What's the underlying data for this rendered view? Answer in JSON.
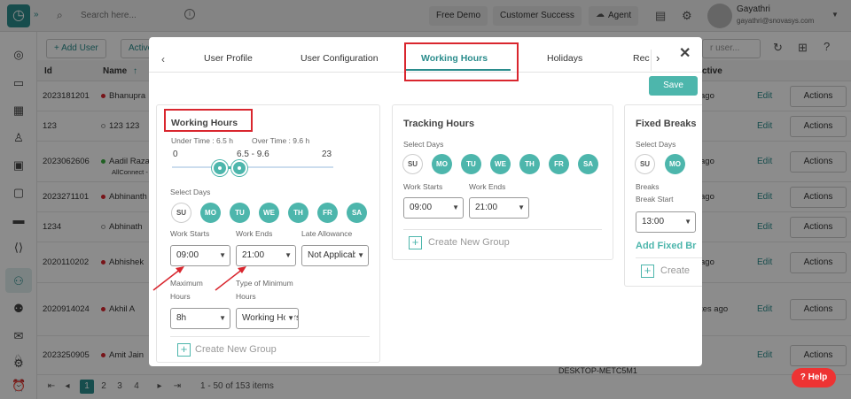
{
  "topbar": {
    "search_placeholder": "Search here...",
    "buttons": [
      "Free Demo",
      "Customer Success",
      "Agent"
    ],
    "user_name": "Gayathri",
    "user_email": "gayathri@snovasys.com"
  },
  "toolbar": {
    "add_user": "Add User",
    "active": "Active",
    "search_user": "r user..."
  },
  "table": {
    "headers": {
      "id": "Id",
      "name": "Name",
      "active": "ctive"
    },
    "rows": [
      {
        "id": "2023181201",
        "name": "Bhanupra",
        "dot": "#d9262e",
        "active": "ago"
      },
      {
        "id": "123",
        "name": "123 123",
        "dot": "",
        "active": ""
      },
      {
        "id": "2023062606",
        "name": "Aadil Raza",
        "sub": "AllConnect -",
        "dot": "#3cb043",
        "active": "ago"
      },
      {
        "id": "2023271101",
        "name": "Abhinanth",
        "dot": "#d9262e",
        "active": "ago"
      },
      {
        "id": "1234",
        "name": "Abhinath",
        "dot": "",
        "active": ""
      },
      {
        "id": "2020110202",
        "name": "Abhishek",
        "dot": "#d9262e",
        "active": "ago"
      },
      {
        "id": "2020914024",
        "name": "Akhil A",
        "dot": "#d9262e",
        "active": "tes ago"
      },
      {
        "id": "2023250905",
        "name": "Amit Jain",
        "dot": "#d9262e",
        "active": ""
      }
    ],
    "edit_label": "Edit",
    "actions_label": "Actions",
    "desktop_name": "DESKTOP-METC5M1"
  },
  "pager": {
    "pages": [
      "1",
      "2",
      "3",
      "4"
    ],
    "range": "1 - 50 of 153 items"
  },
  "help_label": "Help",
  "modal": {
    "tabs": [
      "User Profile",
      "User Configuration",
      "Working Hours",
      "Holidays",
      "Rec"
    ],
    "active_tab": "Working Hours",
    "save_label": "Save",
    "working_hours": {
      "title": "Working Hours",
      "under_time": "Under Time : 6.5 h",
      "over_time": "Over Time : 9.6 h",
      "slider_min": "0",
      "slider_max": "23",
      "slider_range": "6.5 - 9.6",
      "select_days": "Select Days",
      "days": [
        "SU",
        "MO",
        "TU",
        "WE",
        "TH",
        "FR",
        "SA"
      ],
      "work_starts_label": "Work Starts",
      "work_starts": "09:00",
      "work_ends_label": "Work Ends",
      "work_ends": "21:00",
      "late_allowance_label": "Late Allowance",
      "late_allowance": "Not Applicable",
      "maximum_hours_label_1": "Maximum",
      "maximum_hours_label_2": "Hours",
      "maximum_hours": "8h",
      "type_min_label_1": "Type of Minimum",
      "type_min_label_2": "Hours",
      "type_min": "Working Hours",
      "create_group": "Create New Group"
    },
    "tracking_hours": {
      "title": "Tracking Hours",
      "select_days": "Select Days",
      "work_starts_label": "Work Starts",
      "work_starts": "09:00",
      "work_ends_label": "Work Ends",
      "work_ends": "21:00",
      "create_group": "Create New Group"
    },
    "fixed_breaks": {
      "title": "Fixed Breaks",
      "select_days": "Select Days",
      "breaks_label": "Breaks",
      "break_start_label": "Break Start",
      "break_start": "13:00",
      "add_fixed": "Add Fixed Br",
      "create": "Create"
    }
  }
}
